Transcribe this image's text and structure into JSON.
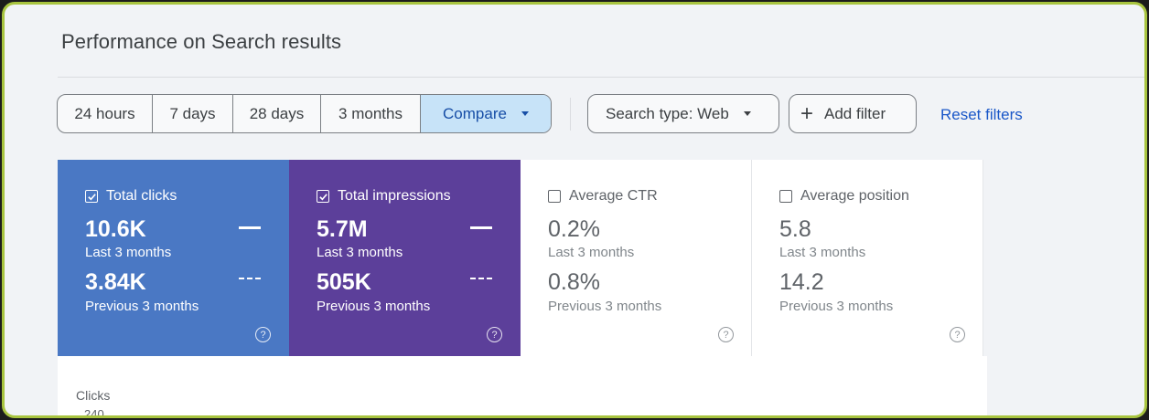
{
  "page_title": "Performance on Search results",
  "date_range": {
    "options": [
      {
        "label": "24 hours"
      },
      {
        "label": "7 days"
      },
      {
        "label": "28 days"
      },
      {
        "label": "3 months"
      },
      {
        "label": "Compare",
        "selected": true
      }
    ]
  },
  "filters": {
    "search_type": "Search type: Web",
    "add_filter": "Add filter",
    "reset": "Reset filters"
  },
  "metrics": [
    {
      "label": "Total clicks",
      "checked": true,
      "current": "10.6K",
      "current_period": "Last 3 months",
      "previous": "3.84K",
      "previous_period": "Previous 3 months",
      "color": "#4a78c4"
    },
    {
      "label": "Total impressions",
      "checked": true,
      "current": "5.7M",
      "current_period": "Last 3 months",
      "previous": "505K",
      "previous_period": "Previous 3 months",
      "color": "#5c3f9a"
    },
    {
      "label": "Average CTR",
      "checked": false,
      "current": "0.2%",
      "current_period": "Last 3 months",
      "previous": "0.8%",
      "previous_period": "Previous 3 months"
    },
    {
      "label": "Average position",
      "checked": false,
      "current": "5.8",
      "current_period": "Last 3 months",
      "previous": "14.2",
      "previous_period": "Previous 3 months"
    }
  ],
  "chart": {
    "y_label": "Clicks",
    "top_tick": "240"
  },
  "colors": {
    "accent_link": "#1a57c8",
    "selected_segment": "#c7e3f8",
    "frame_border": "#a8c43f"
  },
  "icons": {
    "checkbox": "check-icon",
    "dropdown": "chevron-down-icon",
    "add": "plus-icon",
    "help": "help-circle-icon"
  }
}
